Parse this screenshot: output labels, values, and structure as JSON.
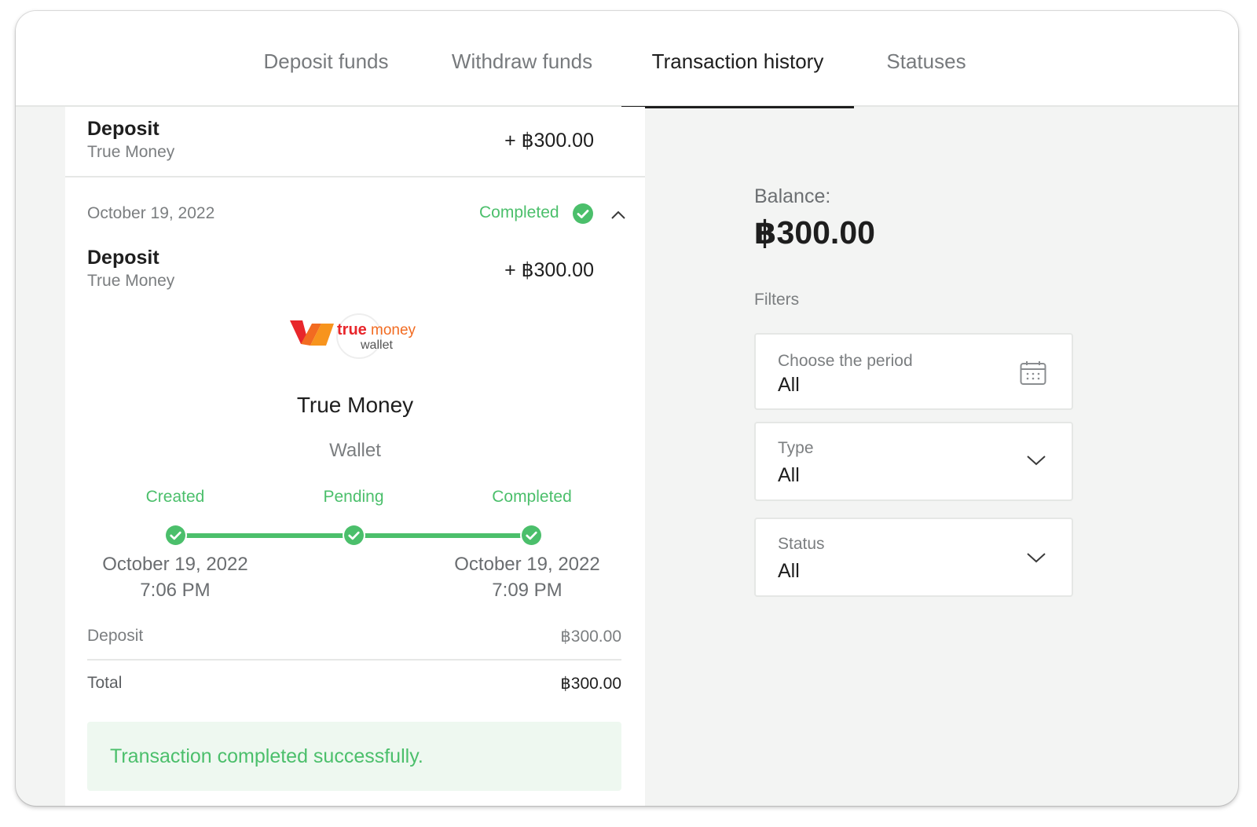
{
  "tabs": [
    {
      "label": "Deposit funds",
      "active": false
    },
    {
      "label": "Withdraw funds",
      "active": false
    },
    {
      "label": "Transaction history",
      "active": true
    },
    {
      "label": "Statuses",
      "active": false
    }
  ],
  "transactions": [
    {
      "title": "Deposit",
      "method": "True Money",
      "amount": "+ ฿300.00"
    },
    {
      "date": "October 19, 2022",
      "status": "Completed",
      "title": "Deposit",
      "method": "True Money",
      "amount": "+ ฿300.00",
      "details": {
        "logo": {
          "brand_word1": "true",
          "brand_word2": "money",
          "brand_word3": "wallet"
        },
        "method_name": "True Money",
        "method_type": "Wallet",
        "steps": [
          {
            "label": "Created",
            "date": "October 19, 2022",
            "time": "7:06 PM"
          },
          {
            "label": "Pending",
            "date": "",
            "time": ""
          },
          {
            "label": "Completed",
            "date": "October 19, 2022",
            "time": "7:09 PM"
          }
        ],
        "summary": {
          "deposit_label": "Deposit",
          "deposit_value": "฿300.00",
          "total_label": "Total",
          "total_value": "฿300.00"
        },
        "message": "Transaction completed successfully."
      }
    }
  ],
  "balance": {
    "label": "Balance:",
    "value": "฿300.00"
  },
  "filters": {
    "label": "Filters",
    "items": [
      {
        "label": "Choose the period",
        "value": "All",
        "icon": "calendar-icon"
      },
      {
        "label": "Type",
        "value": "All",
        "icon": "chevron-down-icon"
      },
      {
        "label": "Status",
        "value": "All",
        "icon": "chevron-down-icon"
      }
    ]
  },
  "colors": {
    "accent_green": "#4bbf6b",
    "success_bg": "#eef8f0",
    "text_dark": "#1e1e1e",
    "text_muted": "#7b7e80",
    "brand_orange": "#f26b21",
    "brand_red": "#e8262b"
  }
}
